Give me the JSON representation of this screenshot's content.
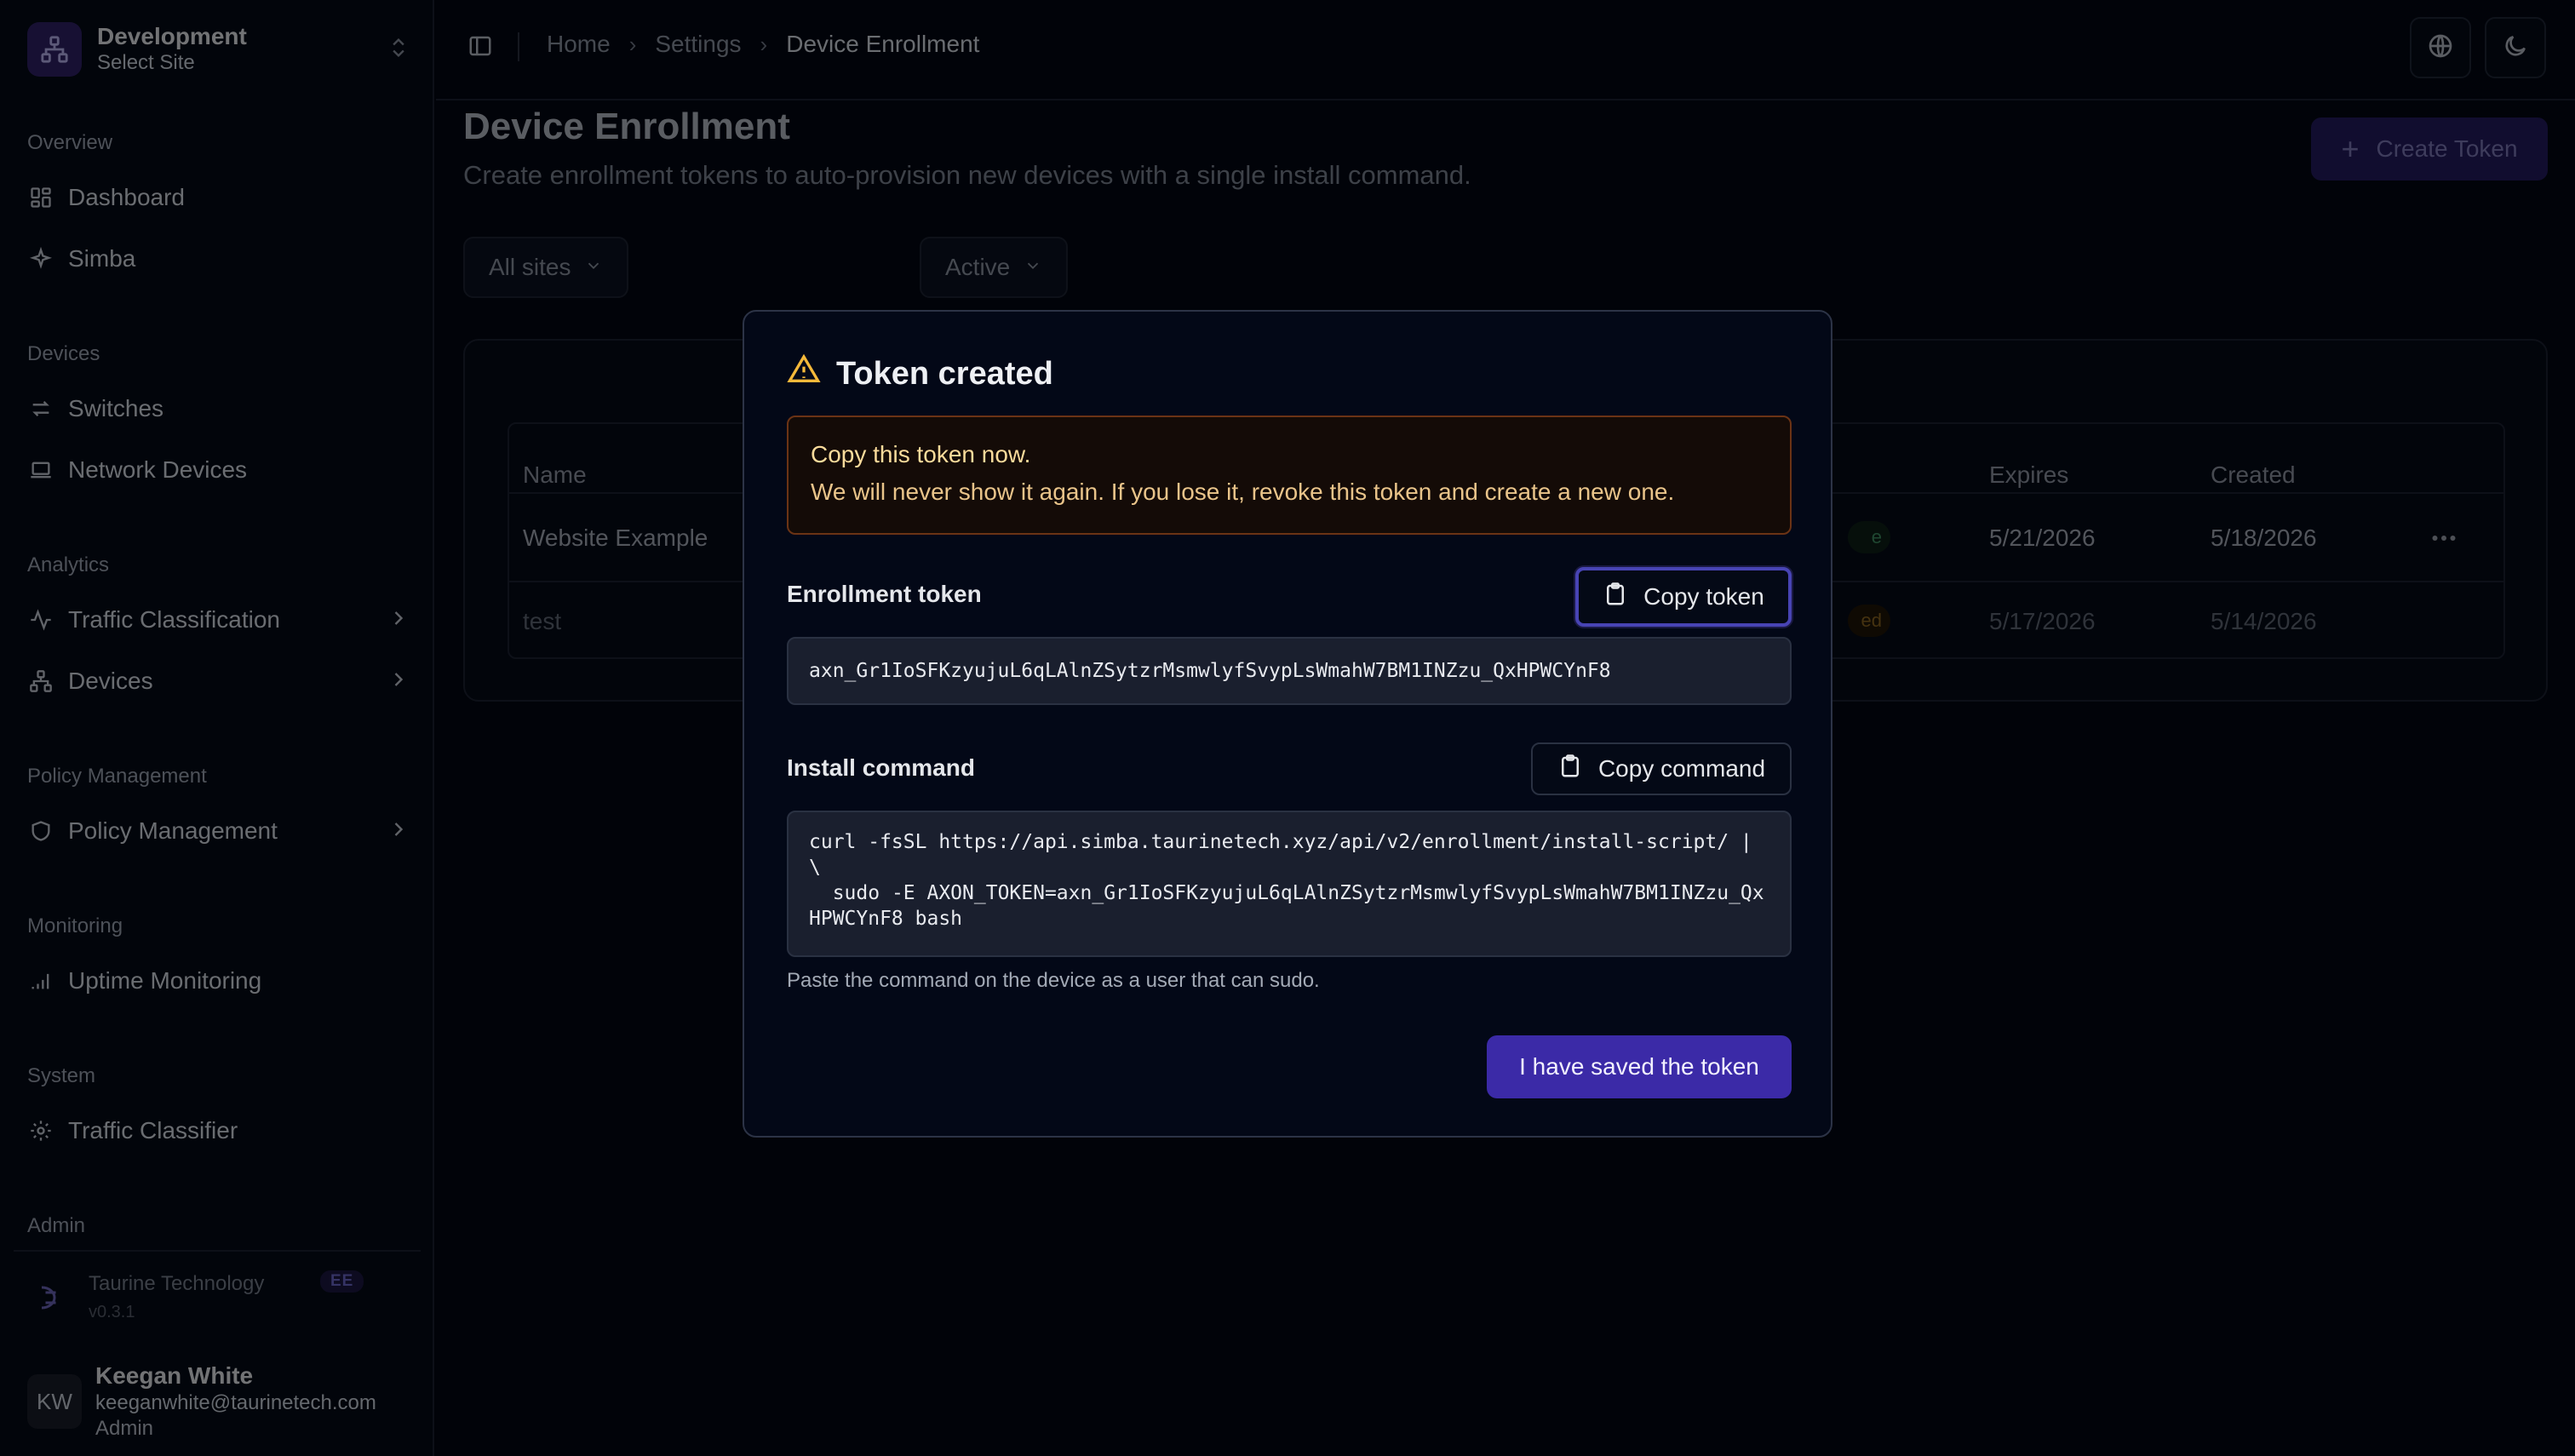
{
  "site": {
    "name": "Development",
    "subtitle": "Select Site"
  },
  "sidebar": {
    "sections": {
      "overview": "Overview",
      "devices": "Devices",
      "analytics": "Analytics",
      "policy": "Policy Management",
      "monitoring": "Monitoring",
      "system": "System",
      "admin": "Admin"
    },
    "items": {
      "dashboard": "Dashboard",
      "simba": "Simba",
      "switches": "Switches",
      "network_devices": "Network Devices",
      "traffic_classification": "Traffic Classification",
      "devices": "Devices",
      "policy_management": "Policy Management",
      "uptime_monitoring": "Uptime Monitoring",
      "traffic_classifier": "Traffic Classifier"
    }
  },
  "org": {
    "name": "Taurine Technology",
    "badge": "EE",
    "version": "v0.3.1"
  },
  "user": {
    "initials": "KW",
    "name": "Keegan White",
    "email": "keeganwhite@taurinetech.com",
    "role": "Admin"
  },
  "breadcrumb": {
    "home": "Home",
    "settings": "Settings",
    "current": "Device Enrollment"
  },
  "page": {
    "title": "Device Enrollment",
    "description": "Create enrollment tokens to auto-provision new devices with a single install command.",
    "create_label": "Create Token"
  },
  "filters": {
    "site": "All sites",
    "status": "Active"
  },
  "table": {
    "headers": {
      "name": "Name",
      "expires": "Expires",
      "created": "Created"
    },
    "rows": [
      {
        "name": "Website Example",
        "status_fragment": "e",
        "expires": "5/21/2026",
        "created": "5/18/2026"
      },
      {
        "name": "test",
        "status_fragment": "ed",
        "expires": "5/17/2026",
        "created": "5/14/2026"
      }
    ]
  },
  "modal": {
    "title": "Token created",
    "alert_title": "Copy this token now.",
    "alert_body": "We will never show it again. If you lose it, revoke this token and create a new one.",
    "token_label": "Enrollment token",
    "copy_token": "Copy token",
    "token": "axn_Gr1IoSFKzyujuL6qLAlnZSytzrMsmwlyfSvypLsWmahW7BM1INZzu_QxHPWCYnF8",
    "command_label": "Install command",
    "copy_command": "Copy command",
    "command": "curl -fsSL https://api.simba.taurinetech.xyz/api/v2/enrollment/install-script/ | \\\n  sudo -E AXON_TOKEN=axn_Gr1IoSFKzyujuL6qLAlnZSytzrMsmwlyfSvypLsWmahW7BM1INZzu_QxHPWCYnF8 bash",
    "hint": "Paste the command on the device as a user that can sudo.",
    "confirm": "I have saved the token"
  },
  "colors": {
    "accent": "#3b2aa7",
    "warning": "#f5b93a",
    "background": "#030712"
  }
}
